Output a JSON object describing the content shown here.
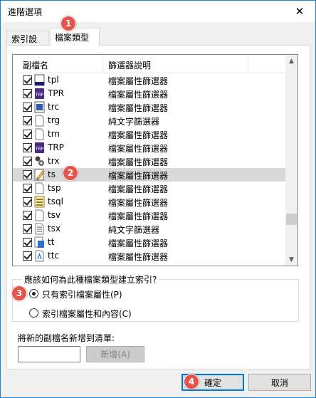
{
  "window": {
    "title": "進階選項",
    "close_glyph": "✕"
  },
  "tabs": [
    {
      "label": "索引設定"
    },
    {
      "label": "檔案類型"
    }
  ],
  "list": {
    "col_ext": "副檔名",
    "col_desc": "篩選器說明",
    "rows": [
      {
        "ext": "tpl",
        "desc": "檔案屬性篩選器",
        "icon": "tpl-file-icon",
        "checked": true
      },
      {
        "ext": "TPR",
        "desc": "檔案屬性篩選器",
        "icon": "trp-file-icon",
        "checked": true
      },
      {
        "ext": "trc",
        "desc": "檔案屬性篩選器",
        "icon": "trc-file-icon",
        "checked": true
      },
      {
        "ext": "trg",
        "desc": "純文字篩選器",
        "icon": "blank-file-icon",
        "checked": true
      },
      {
        "ext": "trn",
        "desc": "檔案屬性篩選器",
        "icon": "blank-file-icon",
        "checked": true
      },
      {
        "ext": "TRP",
        "desc": "檔案屬性篩選器",
        "icon": "trp-file-icon",
        "checked": true
      },
      {
        "ext": "trx",
        "desc": "檔案屬性篩選器",
        "icon": "trx-file-icon",
        "checked": true
      },
      {
        "ext": "ts",
        "desc": "檔案屬性篩選器",
        "icon": "ts-file-icon",
        "checked": true,
        "selected": true
      },
      {
        "ext": "tsp",
        "desc": "檔案屬性篩選器",
        "icon": "blank-file-icon",
        "checked": true
      },
      {
        "ext": "tsql",
        "desc": "檔案屬性篩選器",
        "icon": "tsql-file-icon",
        "checked": true
      },
      {
        "ext": "tsv",
        "desc": "檔案屬性篩選器",
        "icon": "blank-file-icon",
        "checked": true
      },
      {
        "ext": "tsx",
        "desc": "純文字篩選器",
        "icon": "text-file-icon",
        "checked": true
      },
      {
        "ext": "tt",
        "desc": "檔案屬性篩選器",
        "icon": "tt-file-icon",
        "checked": true
      },
      {
        "ext": "ttc",
        "desc": "檔案屬性篩選器",
        "icon": "font-file-icon",
        "checked": true
      }
    ]
  },
  "index_question": "應該如何為此種檔案類型建立索引?",
  "radios": [
    {
      "label": "只有索引檔案屬性(P)",
      "checked": true
    },
    {
      "label": "索引檔案屬性和內容(C)",
      "checked": false
    }
  ],
  "add_section": {
    "label": "將新的副檔名新增到清單:",
    "input_value": "",
    "button": "新增(A)"
  },
  "buttons": {
    "ok": "確定",
    "cancel": "取消"
  },
  "badges": [
    "1",
    "2",
    "3",
    "4"
  ],
  "colors": {
    "accent": "#0078d7",
    "badge": "#e8524a",
    "selected_row": "#d9d9d9"
  }
}
